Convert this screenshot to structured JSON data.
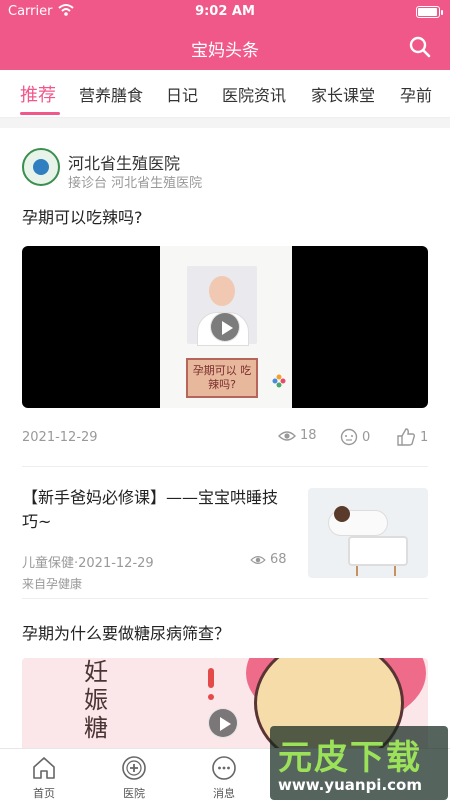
{
  "status_bar": {
    "carrier": "Carrier",
    "time": "9:02 AM"
  },
  "nav": {
    "title": "宝妈头条",
    "search_icon": "search-icon"
  },
  "tabs": [
    {
      "label": "推荐",
      "active": true
    },
    {
      "label": "营养膳食"
    },
    {
      "label": "日记"
    },
    {
      "label": "医院资讯"
    },
    {
      "label": "家长课堂"
    },
    {
      "label": "孕前"
    }
  ],
  "post1": {
    "author": "河北省生殖医院",
    "source": "接诊台 河北省生殖医院",
    "title": "孕期可以吃辣吗?",
    "video_sign": "孕期可以 吃辣吗?",
    "date": "2021-12-29",
    "views": "18",
    "comments": "0",
    "likes": "1"
  },
  "post2": {
    "title": "【新手爸妈必修课】——宝宝哄睡技巧~",
    "meta": "儿童保健·2021-12-29",
    "views": "68",
    "from": "来自孕健康"
  },
  "post3": {
    "title": "孕期为什么要做糖尿病筛查？",
    "cartoon_text": "妊 娠 糖"
  },
  "tabbar": [
    {
      "label": "首页",
      "icon": "home-icon"
    },
    {
      "label": "医院",
      "icon": "hospital-icon"
    },
    {
      "label": "消息",
      "icon": "message-icon"
    }
  ],
  "watermark": {
    "title": "元皮下载",
    "url": "www.yuanpi.com"
  },
  "colors": {
    "accent": "#f0588a"
  }
}
